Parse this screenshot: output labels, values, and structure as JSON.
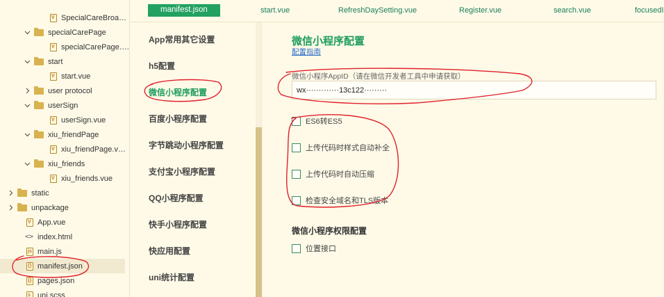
{
  "tree": {
    "rows": [
      {
        "label": "SpecialCareBroa…",
        "kind": "file",
        "file_glyph": "V",
        "depth": 3,
        "chevron": "none"
      },
      {
        "label": "specialCarePage",
        "kind": "folder",
        "depth": 2,
        "chevron": "down"
      },
      {
        "label": "specialCarePage….",
        "kind": "file",
        "file_glyph": "V",
        "depth": 3,
        "chevron": "none"
      },
      {
        "label": "start",
        "kind": "folder",
        "depth": 2,
        "chevron": "down"
      },
      {
        "label": "start.vue",
        "kind": "file",
        "file_glyph": "V",
        "depth": 3,
        "chevron": "none"
      },
      {
        "label": "user protocol",
        "kind": "folder",
        "depth": 2,
        "chevron": "right"
      },
      {
        "label": "userSign",
        "kind": "folder",
        "depth": 2,
        "chevron": "down"
      },
      {
        "label": "userSign.vue",
        "kind": "file",
        "file_glyph": "V",
        "depth": 3,
        "chevron": "none"
      },
      {
        "label": "xiu_friendPage",
        "kind": "folder",
        "depth": 2,
        "chevron": "down"
      },
      {
        "label": "xiu_friendPage.v…",
        "kind": "file",
        "file_glyph": "V",
        "depth": 3,
        "chevron": "none"
      },
      {
        "label": "xiu_friends",
        "kind": "folder",
        "depth": 2,
        "chevron": "down"
      },
      {
        "label": "xiu_friends.vue",
        "kind": "file",
        "file_glyph": "V",
        "depth": 3,
        "chevron": "none"
      },
      {
        "label": "static",
        "kind": "folder",
        "depth": 0,
        "chevron": "right"
      },
      {
        "label": "unpackage",
        "kind": "folder",
        "depth": 0,
        "chevron": "right"
      },
      {
        "label": "App.vue",
        "kind": "file",
        "file_glyph": "V",
        "depth": 1,
        "chevron": "none"
      },
      {
        "label": "index.html",
        "kind": "code",
        "depth": 1,
        "chevron": "none"
      },
      {
        "label": "main.js",
        "kind": "file",
        "file_glyph": "js",
        "depth": 1,
        "chevron": "none"
      },
      {
        "label": "manifest.json",
        "kind": "file",
        "file_glyph": "{}",
        "depth": 1,
        "chevron": "none",
        "selected": true
      },
      {
        "label": "pages.json",
        "kind": "file",
        "file_glyph": "{}",
        "depth": 1,
        "chevron": "none"
      },
      {
        "label": "uni.scss",
        "kind": "file",
        "file_glyph": "s",
        "depth": 1,
        "chevron": "none"
      }
    ]
  },
  "tabs": [
    {
      "label": "manifest.json",
      "active": true
    },
    {
      "label": "start.vue"
    },
    {
      "label": "RefreshDaySetting.vue"
    },
    {
      "label": "Register.vue"
    },
    {
      "label": "search.vue"
    },
    {
      "label": "focusedI"
    }
  ],
  "nav": {
    "items": [
      {
        "label": "App常用其它设置"
      },
      {
        "label": "h5配置"
      },
      {
        "label": "微信小程序配置",
        "active": true
      },
      {
        "label": "百度小程序配置"
      },
      {
        "label": "字节跳动小程序配置"
      },
      {
        "label": "支付宝小程序配置"
      },
      {
        "label": "QQ小程序配置"
      },
      {
        "label": "快手小程序配置"
      },
      {
        "label": "快应用配置"
      },
      {
        "label": "uni统计配置"
      }
    ]
  },
  "main": {
    "title": "微信小程序配置",
    "guide_link": "配置指南",
    "appid_label": "微信小程序AppID（请在微信开发者工具中申请获取）",
    "appid_value": "wx·············13c122·········",
    "options": [
      {
        "label": "ES6转ES5",
        "checked": false
      },
      {
        "label": "上传代码时样式自动补全",
        "checked": false
      },
      {
        "label": "上传代码时自动压缩",
        "checked": false
      },
      {
        "label": "检查安全域名和TLS版本",
        "checked": false
      }
    ],
    "permission_title": "微信小程序权限配置",
    "permissions": [
      {
        "label": "位置接口",
        "checked": false
      }
    ]
  },
  "colors": {
    "accent_green": "#1d9c5e",
    "tab_active_bg": "#23a160",
    "link_blue": "#2b6bc7",
    "annotation_red": "#e0202a",
    "background": "#fffae8"
  }
}
